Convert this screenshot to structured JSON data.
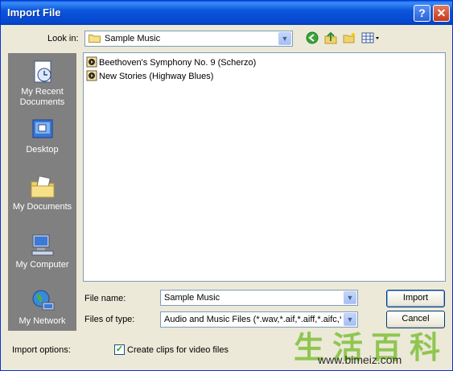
{
  "window": {
    "title": "Import File"
  },
  "titlebar": {
    "help_glyph": "?",
    "close_glyph": "✕"
  },
  "lookin": {
    "label": "Look in:",
    "value": "Sample Music",
    "icon": "folder-icon",
    "toolbar": [
      "back-icon",
      "up-folder-icon",
      "new-folder-icon",
      "view-menu-icon"
    ]
  },
  "places": [
    {
      "label": "My Recent Documents",
      "icon": "recent-documents-icon"
    },
    {
      "label": "Desktop",
      "icon": "desktop-icon"
    },
    {
      "label": "My Documents",
      "icon": "my-documents-icon"
    },
    {
      "label": "My Computer",
      "icon": "my-computer-icon"
    },
    {
      "label": "My Network",
      "icon": "my-network-icon"
    }
  ],
  "files": [
    {
      "name": "Beethoven's Symphony No. 9 (Scherzo)",
      "icon": "media-file-icon"
    },
    {
      "name": "New Stories (Highway Blues)",
      "icon": "media-file-icon"
    }
  ],
  "filename": {
    "label": "File name:",
    "value": "Sample Music"
  },
  "filetype": {
    "label": "Files of type:",
    "value": "Audio and Music Files (*.wav,*.aif,*.aiff,*.aifc,*.s"
  },
  "buttons": {
    "import": "Import",
    "cancel": "Cancel"
  },
  "options": {
    "label": "Import options:",
    "checkbox_label": "Create clips for video files",
    "checked": true
  },
  "watermark": {
    "chars": "生活百科",
    "url": "www.bimeiz.com"
  },
  "colors": {
    "title_bar": "#0b56dc",
    "dialog_bg": "#ece9d8",
    "places_bar": "#808080",
    "close_button": "#c3391b"
  }
}
